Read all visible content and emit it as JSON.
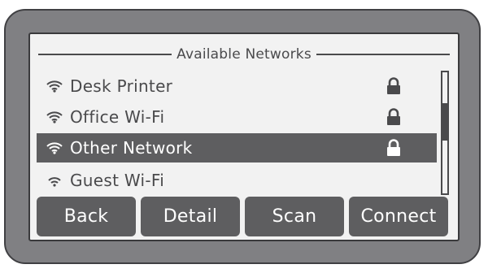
{
  "header": {
    "title": "Available Networks"
  },
  "networks": [
    {
      "name": "Desk Printer",
      "locked": true,
      "selected": false,
      "icon": "wifi-icon"
    },
    {
      "name": "Office Wi-Fi",
      "locked": true,
      "selected": false,
      "icon": "wifi-icon"
    },
    {
      "name": "Other Network",
      "locked": true,
      "selected": true,
      "icon": "wifi-icon"
    },
    {
      "name": "Guest Wi-Fi",
      "locked": false,
      "selected": false,
      "icon": "wifi-icon"
    }
  ],
  "buttons": {
    "back": "Back",
    "detail": "Detail",
    "scan": "Scan",
    "connect": "Connect"
  },
  "colors": {
    "bezel": "#808083",
    "screen": "#f2f2f2",
    "selected_row": "#5e5e60",
    "button": "#5e5e60",
    "text": "#4a4a4c"
  }
}
